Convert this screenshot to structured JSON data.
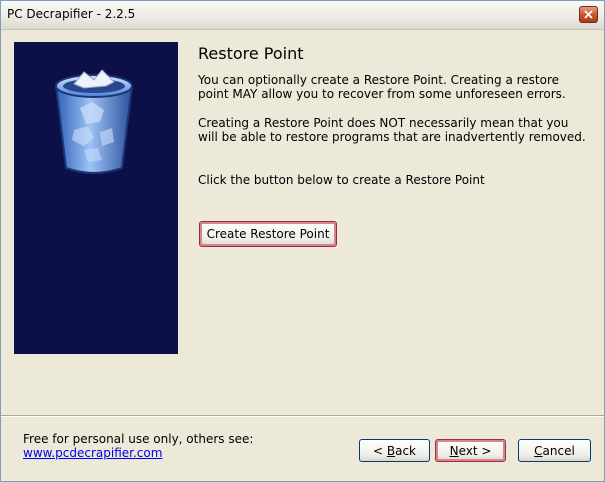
{
  "window": {
    "title": "PC Decrapifier - 2.2.5"
  },
  "page": {
    "heading": "Restore Point",
    "paragraph1": "You can optionally create a Restore Point.  Creating a restore point MAY allow you to recover from some unforeseen errors.",
    "paragraph2": "Creating a Restore Point does NOT necessarily mean that you will be able to restore programs that are inadvertently removed.",
    "paragraph3": "Click the button below to create a Restore Point",
    "create_button_label": "Create Restore Point"
  },
  "footer": {
    "note": "Free for personal use only, others see:",
    "link": "www.pcdecrapifier.com",
    "back_prefix": "< ",
    "back_mnemonic": "B",
    "back_rest": "ack",
    "next_mnemonic": "N",
    "next_rest": "ext >",
    "cancel_mnemonic": "C",
    "cancel_rest": "ancel"
  },
  "icons": {
    "side_panel": "recycle-bin-icon",
    "close": "close-icon"
  },
  "colors": {
    "side_panel_bg": "#0d0f47",
    "focus_ring": "#d6848e",
    "link": "#0000ee"
  }
}
